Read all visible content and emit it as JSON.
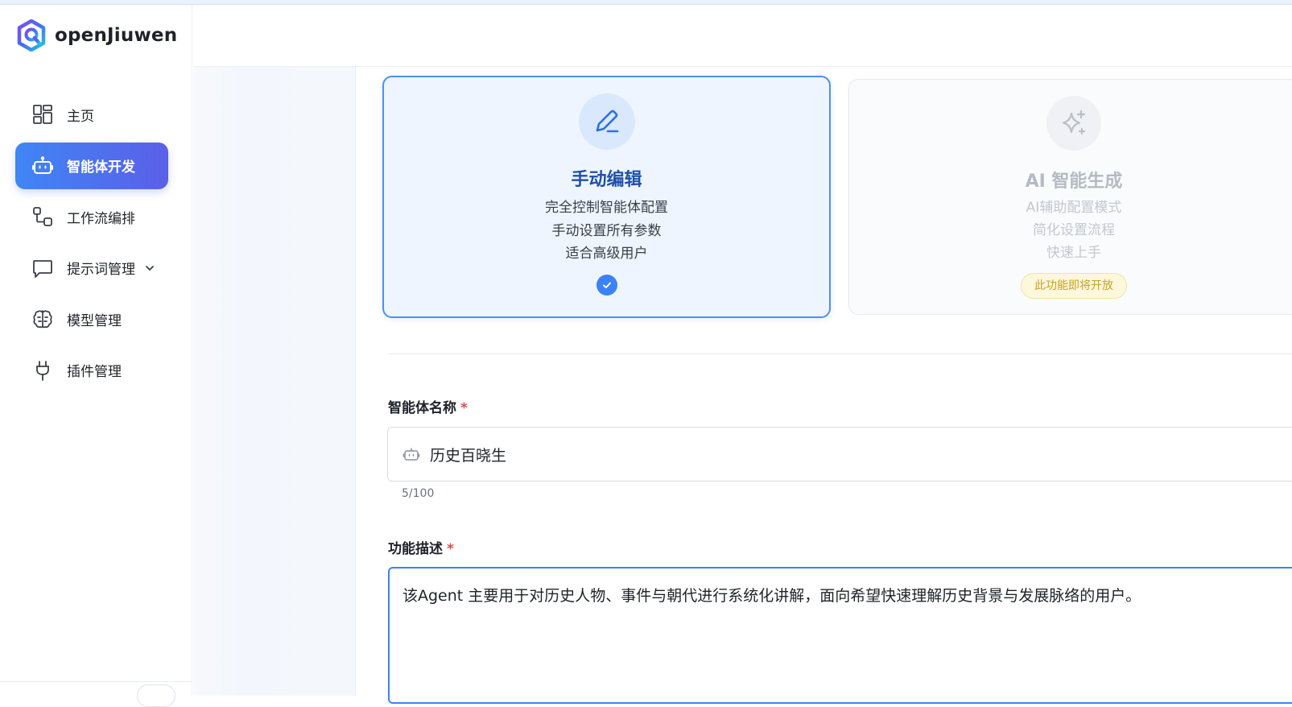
{
  "brand": {
    "name": "openJiuwen",
    "accent": "#3f86f5",
    "accent2": "#5b5fe8"
  },
  "sidebar": {
    "items": [
      {
        "label": "主页",
        "icon": "dashboard-icon",
        "active": false
      },
      {
        "label": "智能体开发",
        "icon": "robot-icon",
        "active": true
      },
      {
        "label": "工作流编排",
        "icon": "workflow-icon",
        "active": false
      },
      {
        "label": "提示词管理",
        "icon": "chat-bubble-icon",
        "active": false,
        "has_submenu": true
      },
      {
        "label": "模型管理",
        "icon": "brain-icon",
        "active": false
      },
      {
        "label": "插件管理",
        "icon": "plug-icon",
        "active": false
      }
    ]
  },
  "modes": {
    "manual": {
      "title": "手动编辑",
      "lines": [
        "完全控制智能体配置",
        "手动设置所有参数",
        "适合高级用户"
      ],
      "selected": true,
      "icon": "pencil-icon"
    },
    "ai": {
      "title": "AI 智能生成",
      "lines": [
        "AI辅助配置模式",
        "简化设置流程",
        "快速上手"
      ],
      "badge": "此功能即将开放",
      "icon": "sparkle-icon"
    }
  },
  "form": {
    "name_label": "智能体名称",
    "name_value": "历史百晓生",
    "name_counter": "5/100",
    "desc_label": "功能描述",
    "desc_value": "该Agent 主要用于对历史人物、事件与朝代进行系统化讲解，面向希望快速理解历史背景与发展脉络的用户。",
    "required_mark": "*"
  }
}
